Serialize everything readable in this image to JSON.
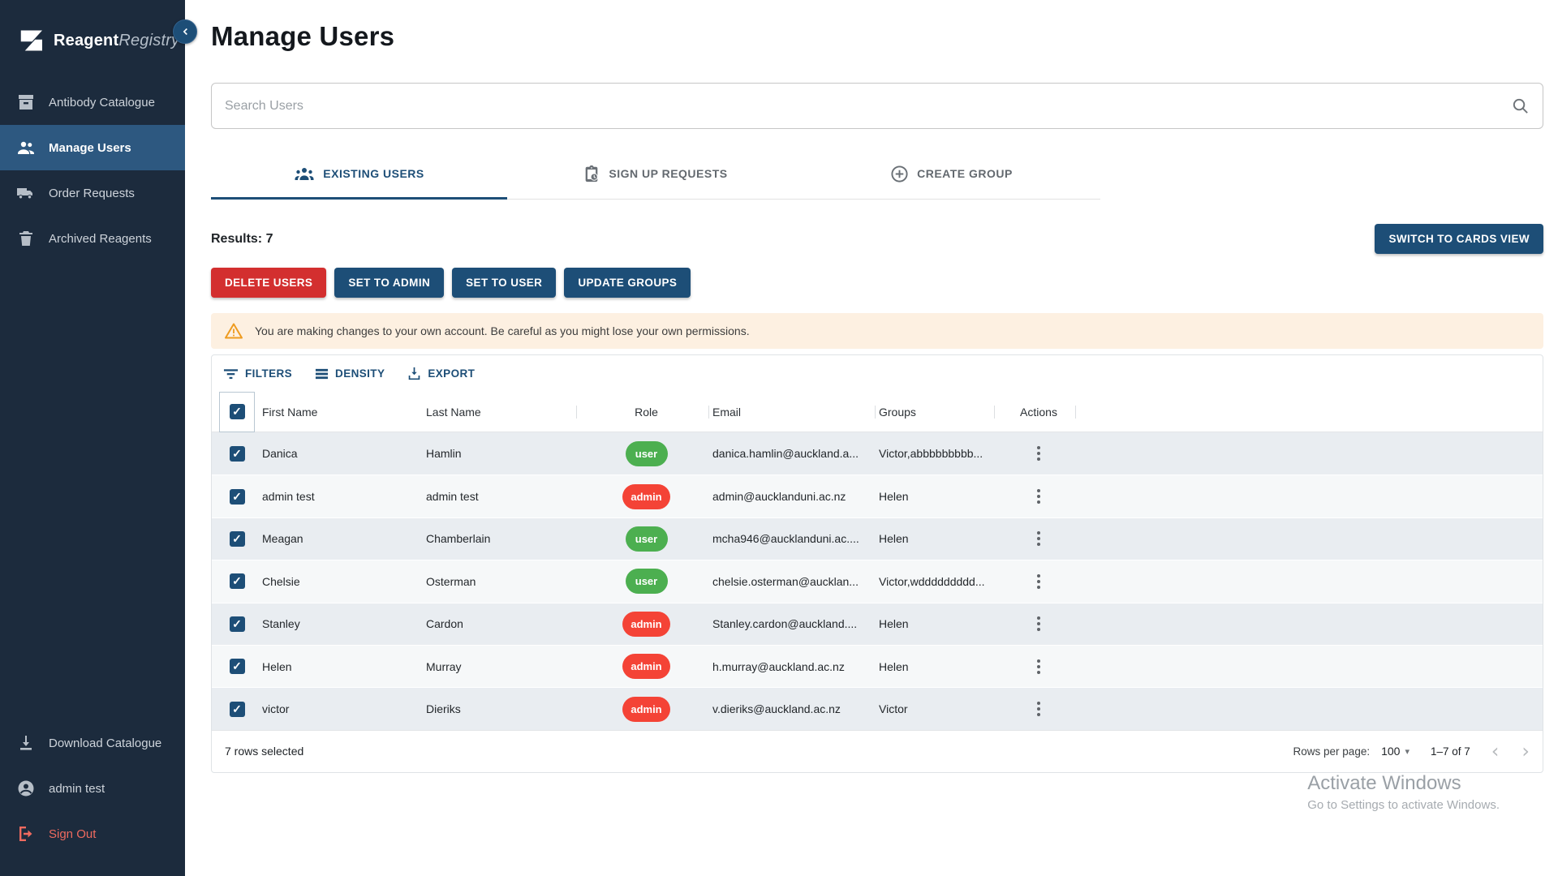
{
  "brand": {
    "bold": "Reagent",
    "italic": "Registry"
  },
  "colors": {
    "sidebar_bg": "#1c2b3d",
    "sidebar_active": "#2d5880",
    "accent_navy": "#1d4e77",
    "danger_red": "#d32f2f",
    "pill_user_green": "#4caf50",
    "pill_admin_red": "#f44336",
    "warning_bg": "#fdf0e1",
    "row_odd": "#e9edf1",
    "row_even": "#f6f8f9"
  },
  "sidebar": {
    "items": [
      {
        "label": "Antibody Catalogue",
        "icon": "inventory-box-icon"
      },
      {
        "label": "Manage Users",
        "icon": "people-icon",
        "active": true
      },
      {
        "label": "Order Requests",
        "icon": "truck-icon"
      },
      {
        "label": "Archived Reagents",
        "icon": "trash-icon"
      }
    ],
    "bottom_items": [
      {
        "label": "Download Catalogue",
        "icon": "download-icon"
      },
      {
        "label": "admin test",
        "icon": "account-circle-icon"
      },
      {
        "label": "Sign Out",
        "icon": "logout-icon"
      }
    ]
  },
  "header": {
    "title": "Manage Users"
  },
  "search": {
    "placeholder": "Search Users"
  },
  "tabs": [
    {
      "label": "EXISTING USERS",
      "icon": "groups-icon",
      "active": true
    },
    {
      "label": "SIGN UP REQUESTS",
      "icon": "signup-clipboard-icon",
      "active": false
    },
    {
      "label": "CREATE GROUP",
      "icon": "add-circle-icon",
      "active": false
    }
  ],
  "results": {
    "label": "Results: 7"
  },
  "view_toggle": {
    "label": "SWITCH TO CARDS VIEW"
  },
  "bulk_actions": {
    "delete": "DELETE USERS",
    "set_admin": "SET TO ADMIN",
    "set_user": "SET TO USER",
    "update_groups": "UPDATE GROUPS"
  },
  "warning": {
    "text": "You are making changes to your own account. Be careful as you might lose your own permissions."
  },
  "table": {
    "toolbar": {
      "filters": "FILTERS",
      "density": "DENSITY",
      "export": "EXPORT"
    },
    "columns": {
      "first_name": "First Name",
      "last_name": "Last Name",
      "role": "Role",
      "email": "Email",
      "groups": "Groups",
      "actions": "Actions"
    },
    "rows": [
      {
        "first_name": "Danica",
        "last_name": "Hamlin",
        "role": "user",
        "email": "danica.hamlin@auckland.a...",
        "groups": "Victor,abbbbbbbbb..."
      },
      {
        "first_name": "admin test",
        "last_name": "admin test",
        "role": "admin",
        "email": "admin@aucklanduni.ac.nz",
        "groups": "Helen"
      },
      {
        "first_name": "Meagan",
        "last_name": "Chamberlain",
        "role": "user",
        "email": "mcha946@aucklanduni.ac....",
        "groups": "Helen"
      },
      {
        "first_name": "Chelsie",
        "last_name": "Osterman",
        "role": "user",
        "email": "chelsie.osterman@aucklan...",
        "groups": "Victor,wddddddddd..."
      },
      {
        "first_name": "Stanley",
        "last_name": "Cardon",
        "role": "admin",
        "email": "Stanley.cardon@auckland....",
        "groups": "Helen"
      },
      {
        "first_name": "Helen",
        "last_name": "Murray",
        "role": "admin",
        "email": "h.murray@auckland.ac.nz",
        "groups": "Helen"
      },
      {
        "first_name": "victor",
        "last_name": "Dieriks",
        "role": "admin",
        "email": "v.dieriks@auckland.ac.nz",
        "groups": "Victor"
      }
    ],
    "footer": {
      "selected": "7 rows selected",
      "rows_per_page_label": "Rows per page:",
      "rows_per_page_value": "100",
      "range": "1–7 of 7"
    }
  },
  "watermark": {
    "line1": "Activate Windows",
    "line2": "Go to Settings to activate Windows."
  }
}
